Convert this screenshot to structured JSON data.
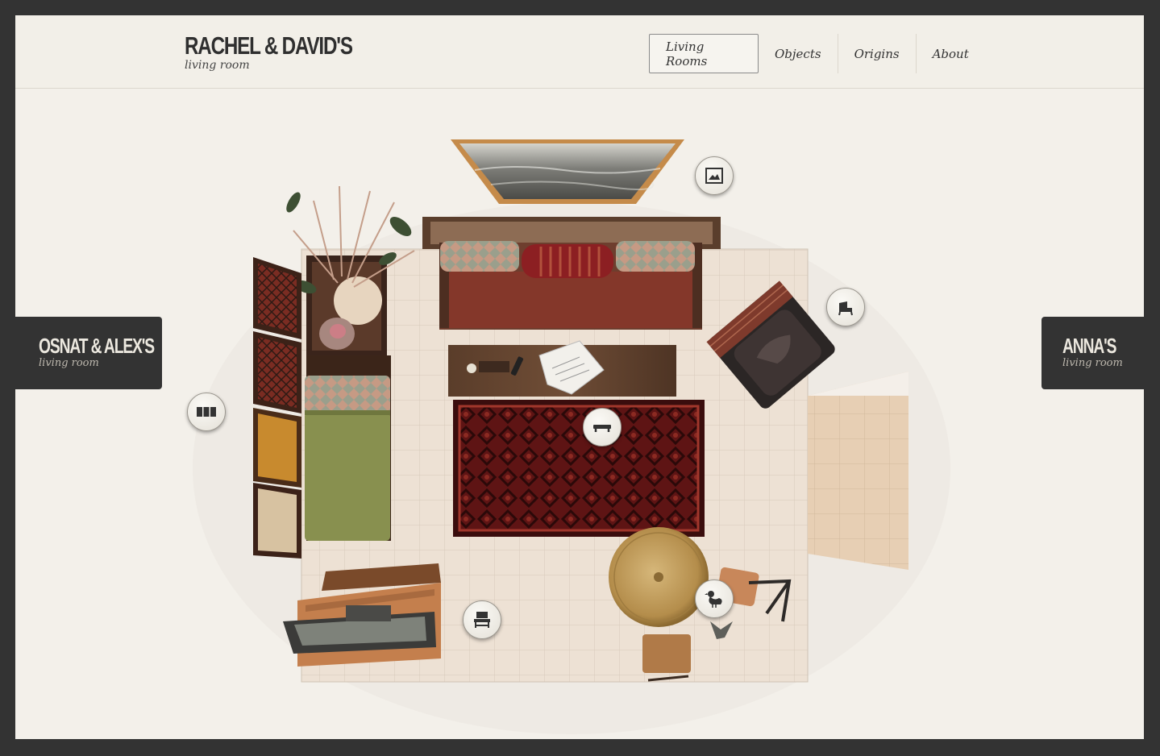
{
  "header": {
    "title": "RACHEL & DAVID'S",
    "subtitle": "living room"
  },
  "nav": {
    "items": [
      {
        "label": "Living Rooms",
        "active": true
      },
      {
        "label": "Objects"
      },
      {
        "label": "Origins"
      },
      {
        "label": "About"
      }
    ]
  },
  "prev_room": {
    "title": "OSNAT & ALEX'S",
    "subtitle": "living room"
  },
  "next_room": {
    "title": "ANNA'S",
    "subtitle": "living room"
  },
  "hotspots": [
    {
      "icon": "picture-frame-icon"
    },
    {
      "icon": "armchair-icon"
    },
    {
      "icon": "bookshelf-icon"
    },
    {
      "icon": "coffee-table-icon"
    },
    {
      "icon": "bench-icon"
    },
    {
      "icon": "duck-icon"
    }
  ],
  "colors": {
    "frame": "#333333",
    "page_bg": "#f3f0ea",
    "tab_bg": "#333333"
  }
}
